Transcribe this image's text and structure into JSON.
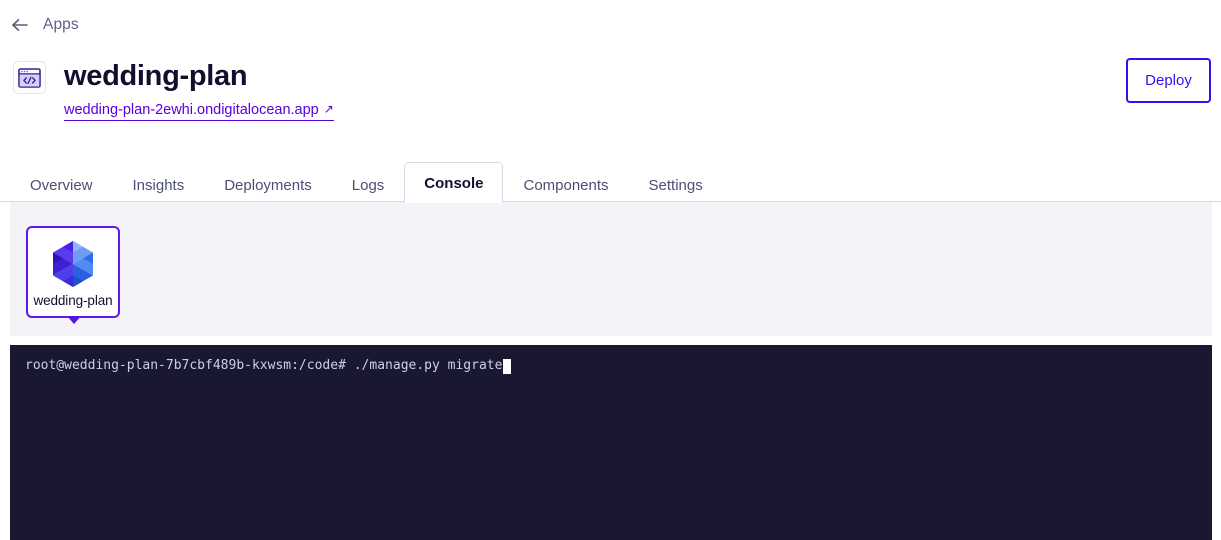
{
  "breadcrumb": {
    "back_icon": "arrow-left-icon",
    "label": "Apps"
  },
  "header": {
    "app_icon": "code-window-icon",
    "title": "wedding-plan",
    "url": "wedding-plan-2ewhi.ondigitalocean.app",
    "url_external_glyph": "↗",
    "deploy_label": "Deploy",
    "accent_color": "#3b0bf5",
    "link_color": "#5a00e0"
  },
  "tabs": {
    "items": [
      {
        "label": "Overview",
        "active": false
      },
      {
        "label": "Insights",
        "active": false
      },
      {
        "label": "Deployments",
        "active": false
      },
      {
        "label": "Logs",
        "active": false
      },
      {
        "label": "Console",
        "active": true
      },
      {
        "label": "Components",
        "active": false
      },
      {
        "label": "Settings",
        "active": false
      }
    ]
  },
  "component_strip": {
    "background_color": "#f3f3f8",
    "cards": [
      {
        "name": "wedding-plan",
        "icon": "gem-cube-icon",
        "selected": true,
        "border_color": "#6316e8"
      }
    ]
  },
  "terminal": {
    "background_color": "#1a1730",
    "text_color": "#ccd0e6",
    "prompt": "root@wedding-plan-7b7cbf489b-kxwsm:/code#",
    "command": " ./manage.py migrate",
    "cursor_visible": true
  }
}
